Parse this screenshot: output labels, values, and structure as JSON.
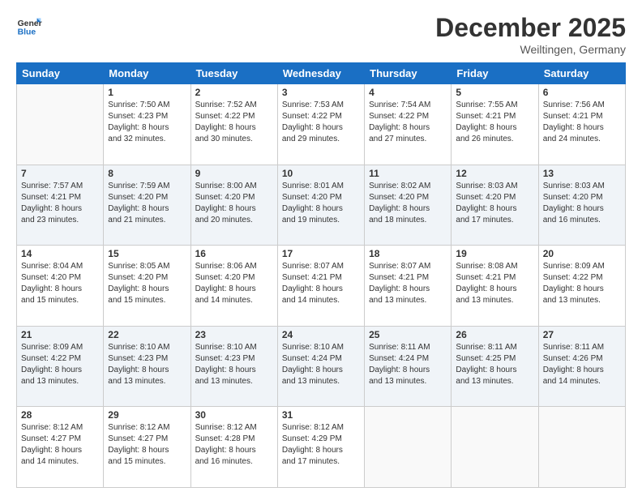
{
  "header": {
    "logo_line1": "General",
    "logo_line2": "Blue",
    "title": "December 2025",
    "subtitle": "Weiltingen, Germany"
  },
  "weekdays": [
    "Sunday",
    "Monday",
    "Tuesday",
    "Wednesday",
    "Thursday",
    "Friday",
    "Saturday"
  ],
  "weeks": [
    [
      {
        "day": "",
        "info": ""
      },
      {
        "day": "1",
        "info": "Sunrise: 7:50 AM\nSunset: 4:23 PM\nDaylight: 8 hours\nand 32 minutes."
      },
      {
        "day": "2",
        "info": "Sunrise: 7:52 AM\nSunset: 4:22 PM\nDaylight: 8 hours\nand 30 minutes."
      },
      {
        "day": "3",
        "info": "Sunrise: 7:53 AM\nSunset: 4:22 PM\nDaylight: 8 hours\nand 29 minutes."
      },
      {
        "day": "4",
        "info": "Sunrise: 7:54 AM\nSunset: 4:22 PM\nDaylight: 8 hours\nand 27 minutes."
      },
      {
        "day": "5",
        "info": "Sunrise: 7:55 AM\nSunset: 4:21 PM\nDaylight: 8 hours\nand 26 minutes."
      },
      {
        "day": "6",
        "info": "Sunrise: 7:56 AM\nSunset: 4:21 PM\nDaylight: 8 hours\nand 24 minutes."
      }
    ],
    [
      {
        "day": "7",
        "info": "Sunrise: 7:57 AM\nSunset: 4:21 PM\nDaylight: 8 hours\nand 23 minutes."
      },
      {
        "day": "8",
        "info": "Sunrise: 7:59 AM\nSunset: 4:20 PM\nDaylight: 8 hours\nand 21 minutes."
      },
      {
        "day": "9",
        "info": "Sunrise: 8:00 AM\nSunset: 4:20 PM\nDaylight: 8 hours\nand 20 minutes."
      },
      {
        "day": "10",
        "info": "Sunrise: 8:01 AM\nSunset: 4:20 PM\nDaylight: 8 hours\nand 19 minutes."
      },
      {
        "day": "11",
        "info": "Sunrise: 8:02 AM\nSunset: 4:20 PM\nDaylight: 8 hours\nand 18 minutes."
      },
      {
        "day": "12",
        "info": "Sunrise: 8:03 AM\nSunset: 4:20 PM\nDaylight: 8 hours\nand 17 minutes."
      },
      {
        "day": "13",
        "info": "Sunrise: 8:03 AM\nSunset: 4:20 PM\nDaylight: 8 hours\nand 16 minutes."
      }
    ],
    [
      {
        "day": "14",
        "info": "Sunrise: 8:04 AM\nSunset: 4:20 PM\nDaylight: 8 hours\nand 15 minutes."
      },
      {
        "day": "15",
        "info": "Sunrise: 8:05 AM\nSunset: 4:20 PM\nDaylight: 8 hours\nand 15 minutes."
      },
      {
        "day": "16",
        "info": "Sunrise: 8:06 AM\nSunset: 4:20 PM\nDaylight: 8 hours\nand 14 minutes."
      },
      {
        "day": "17",
        "info": "Sunrise: 8:07 AM\nSunset: 4:21 PM\nDaylight: 8 hours\nand 14 minutes."
      },
      {
        "day": "18",
        "info": "Sunrise: 8:07 AM\nSunset: 4:21 PM\nDaylight: 8 hours\nand 13 minutes."
      },
      {
        "day": "19",
        "info": "Sunrise: 8:08 AM\nSunset: 4:21 PM\nDaylight: 8 hours\nand 13 minutes."
      },
      {
        "day": "20",
        "info": "Sunrise: 8:09 AM\nSunset: 4:22 PM\nDaylight: 8 hours\nand 13 minutes."
      }
    ],
    [
      {
        "day": "21",
        "info": "Sunrise: 8:09 AM\nSunset: 4:22 PM\nDaylight: 8 hours\nand 13 minutes."
      },
      {
        "day": "22",
        "info": "Sunrise: 8:10 AM\nSunset: 4:23 PM\nDaylight: 8 hours\nand 13 minutes."
      },
      {
        "day": "23",
        "info": "Sunrise: 8:10 AM\nSunset: 4:23 PM\nDaylight: 8 hours\nand 13 minutes."
      },
      {
        "day": "24",
        "info": "Sunrise: 8:10 AM\nSunset: 4:24 PM\nDaylight: 8 hours\nand 13 minutes."
      },
      {
        "day": "25",
        "info": "Sunrise: 8:11 AM\nSunset: 4:24 PM\nDaylight: 8 hours\nand 13 minutes."
      },
      {
        "day": "26",
        "info": "Sunrise: 8:11 AM\nSunset: 4:25 PM\nDaylight: 8 hours\nand 13 minutes."
      },
      {
        "day": "27",
        "info": "Sunrise: 8:11 AM\nSunset: 4:26 PM\nDaylight: 8 hours\nand 14 minutes."
      }
    ],
    [
      {
        "day": "28",
        "info": "Sunrise: 8:12 AM\nSunset: 4:27 PM\nDaylight: 8 hours\nand 14 minutes."
      },
      {
        "day": "29",
        "info": "Sunrise: 8:12 AM\nSunset: 4:27 PM\nDaylight: 8 hours\nand 15 minutes."
      },
      {
        "day": "30",
        "info": "Sunrise: 8:12 AM\nSunset: 4:28 PM\nDaylight: 8 hours\nand 16 minutes."
      },
      {
        "day": "31",
        "info": "Sunrise: 8:12 AM\nSunset: 4:29 PM\nDaylight: 8 hours\nand 17 minutes."
      },
      {
        "day": "",
        "info": ""
      },
      {
        "day": "",
        "info": ""
      },
      {
        "day": "",
        "info": ""
      }
    ]
  ]
}
